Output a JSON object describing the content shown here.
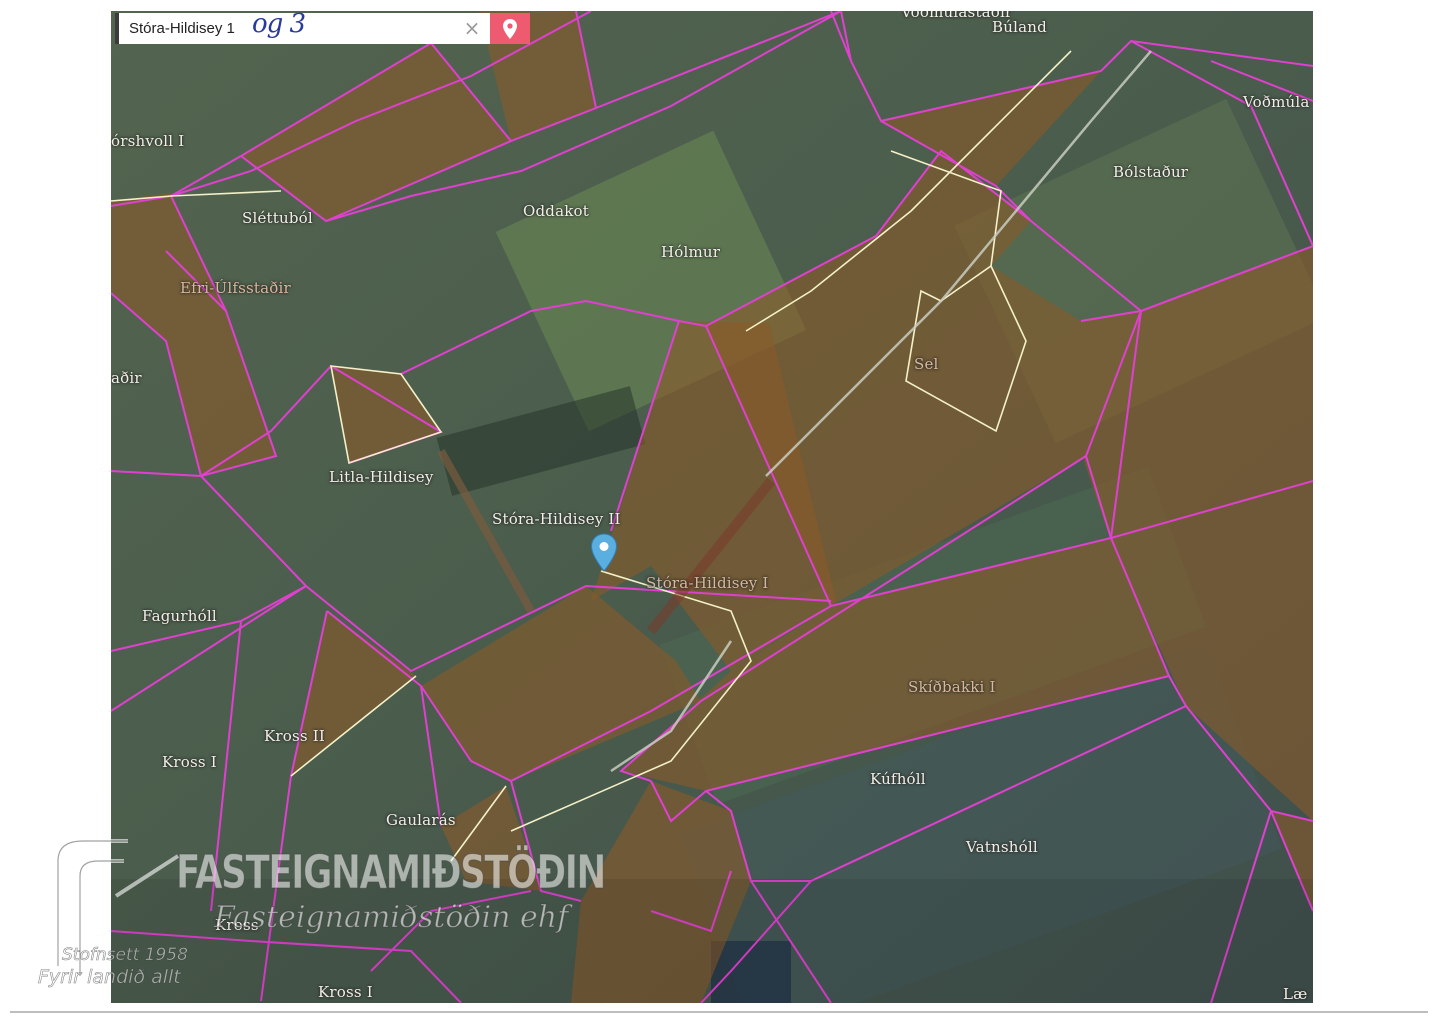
{
  "search": {
    "value": "Stóra-Hildisey 1",
    "annotation": "og 3",
    "clear_icon": "close-icon",
    "locate_icon": "map-pin-icon"
  },
  "colors": {
    "accent": "#ee5a6f",
    "boundary": "#e040d0",
    "selected_outline": "#f4f0c8",
    "parcel_fill": "#8a5a2a",
    "marker": "#5aaee0"
  },
  "farms": [
    {
      "name": "Voðmúlastaðir",
      "faded": false
    },
    {
      "name": "Búland",
      "faded": false
    },
    {
      "name": "Voðmúla",
      "faded": false
    },
    {
      "name": "órshvoll I",
      "faded": false
    },
    {
      "name": "Bólstaður",
      "faded": false
    },
    {
      "name": "Sléttuból",
      "faded": false
    },
    {
      "name": "Oddakot",
      "faded": false
    },
    {
      "name": "Hólmur",
      "faded": false
    },
    {
      "name": "Efri-Úlfsstaðir",
      "faded": true
    },
    {
      "name": "Sel",
      "faded": true
    },
    {
      "name": "aðir",
      "faded": false
    },
    {
      "name": "Litla-Hildisey",
      "faded": false
    },
    {
      "name": "Stóra-Hildisey II",
      "faded": false
    },
    {
      "name": "Stóra-Hildisey I",
      "faded": true
    },
    {
      "name": "Fagurhóll",
      "faded": false
    },
    {
      "name": "Skíðbakki I",
      "faded": true
    },
    {
      "name": "Kross II",
      "faded": false
    },
    {
      "name": "Kross I",
      "faded": false
    },
    {
      "name": "Kúfhóll",
      "faded": false
    },
    {
      "name": "Gaularás",
      "faded": false
    },
    {
      "name": "Vatnshóll",
      "faded": false
    },
    {
      "name": "Kross",
      "faded": false
    },
    {
      "name": "Kross I",
      "faded": false
    },
    {
      "name": "Læ",
      "faded": false
    }
  ],
  "watermark": {
    "brand": "FASTEIGNAMIÐSTÖÐIN",
    "company": "Fasteignamiðstöðin ehf",
    "founded": "Stofnsett 1958",
    "slogan": "Fyrir landið allt"
  }
}
